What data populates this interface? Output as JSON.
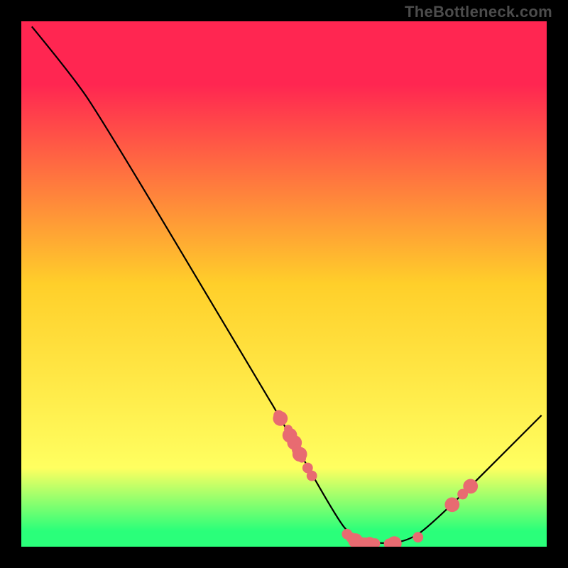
{
  "watermark": "TheBottleneck.com",
  "chart_data": {
    "type": "line",
    "title": "",
    "xlabel": "",
    "ylabel": "",
    "xlim": [
      0,
      100
    ],
    "ylim": [
      0,
      100
    ],
    "gradient_stops": [
      {
        "offset": 12,
        "color": "#ff2651"
      },
      {
        "offset": 50,
        "color": "#ffcf2a"
      },
      {
        "offset": 85,
        "color": "#ffff60"
      },
      {
        "offset": 97,
        "color": "#2aff7a"
      }
    ],
    "series": [
      {
        "name": "bottleneck-curve",
        "path": [
          {
            "x": 2,
            "y": 99
          },
          {
            "x": 9,
            "y": 90.5
          },
          {
            "x": 15,
            "y": 82
          },
          {
            "x": 46,
            "y": 30
          },
          {
            "x": 49,
            "y": 25
          },
          {
            "x": 60,
            "y": 5.5
          },
          {
            "x": 63,
            "y": 1.8
          },
          {
            "x": 67,
            "y": 0.6
          },
          {
            "x": 73,
            "y": 0.8
          },
          {
            "x": 78,
            "y": 4
          },
          {
            "x": 99,
            "y": 25
          }
        ]
      }
    ],
    "dots": [
      {
        "x": 49.0,
        "y": 25.0,
        "r": 1.0
      },
      {
        "x": 49.3,
        "y": 24.4,
        "r": 1.4
      },
      {
        "x": 50.8,
        "y": 22.4,
        "r": 0.8
      },
      {
        "x": 51.1,
        "y": 21.2,
        "r": 1.4
      },
      {
        "x": 51.4,
        "y": 20.5,
        "r": 1.0
      },
      {
        "x": 52.0,
        "y": 19.8,
        "r": 1.4
      },
      {
        "x": 52.5,
        "y": 18.4,
        "r": 1.0
      },
      {
        "x": 53.0,
        "y": 17.6,
        "r": 1.4
      },
      {
        "x": 53.4,
        "y": 16.8,
        "r": 0.8
      },
      {
        "x": 54.5,
        "y": 15.0,
        "r": 1.0
      },
      {
        "x": 55.3,
        "y": 13.5,
        "r": 1.0
      },
      {
        "x": 62.0,
        "y": 2.4,
        "r": 1.0
      },
      {
        "x": 62.8,
        "y": 1.7,
        "r": 1.0
      },
      {
        "x": 63.6,
        "y": 1.15,
        "r": 1.4
      },
      {
        "x": 64.5,
        "y": 0.9,
        "r": 1.0
      },
      {
        "x": 65.4,
        "y": 0.75,
        "r": 1.0
      },
      {
        "x": 66.3,
        "y": 0.65,
        "r": 1.2
      },
      {
        "x": 67.3,
        "y": 0.6,
        "r": 1.0
      },
      {
        "x": 70.0,
        "y": 0.55,
        "r": 1.0
      },
      {
        "x": 71.0,
        "y": 0.6,
        "r": 1.4
      },
      {
        "x": 75.5,
        "y": 1.8,
        "r": 1.0
      },
      {
        "x": 82.0,
        "y": 8.0,
        "r": 1.4
      },
      {
        "x": 84.0,
        "y": 10.0,
        "r": 1.0
      },
      {
        "x": 85.5,
        "y": 11.5,
        "r": 1.4
      }
    ],
    "dot_color": "#e86b71",
    "curve_color": "#000000"
  }
}
